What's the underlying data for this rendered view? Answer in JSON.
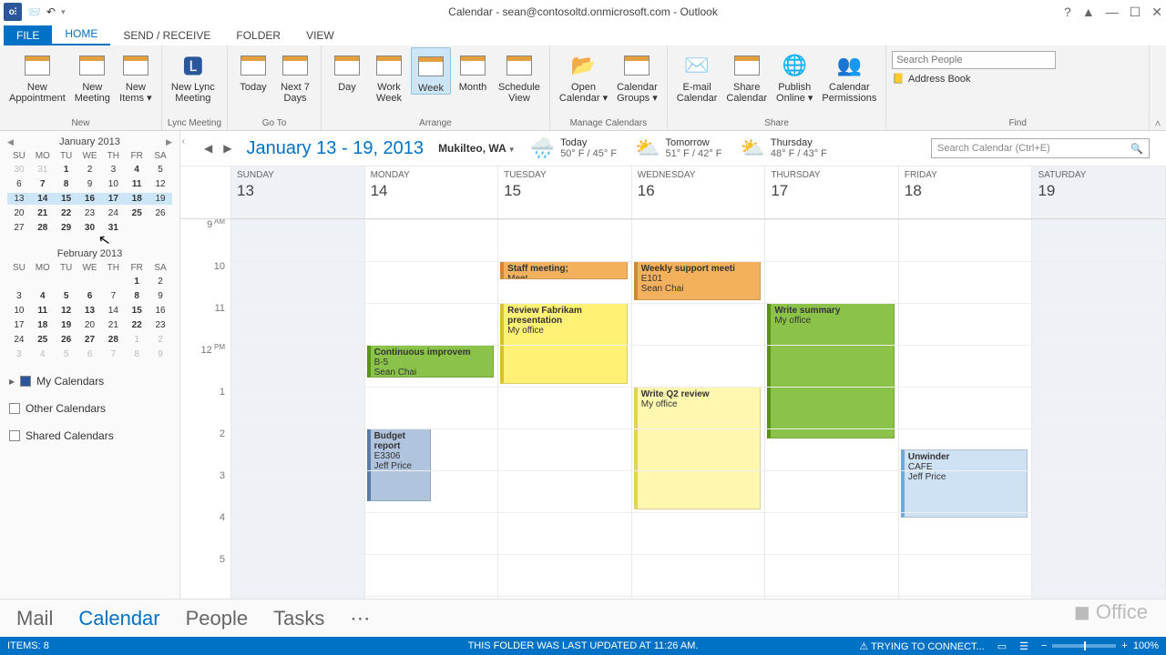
{
  "window": {
    "title": "Calendar - sean@contosoltd.onmicrosoft.com - Outlook"
  },
  "tabs": {
    "file": "FILE",
    "home": "HOME",
    "sendreceive": "SEND / RECEIVE",
    "folder": "FOLDER",
    "view": "VIEW"
  },
  "ribbon": {
    "new": {
      "label": "New",
      "new_appointment": "New\nAppointment",
      "new_meeting": "New\nMeeting",
      "new_items": "New\nItems ▾"
    },
    "lync": {
      "label": "Lync Meeting",
      "btn": "New Lync\nMeeting"
    },
    "goto": {
      "label": "Go To",
      "today": "Today",
      "next7": "Next 7\nDays"
    },
    "arrange": {
      "label": "Arrange",
      "day": "Day",
      "workweek": "Work\nWeek",
      "week": "Week",
      "month": "Month",
      "schedule": "Schedule\nView"
    },
    "manage": {
      "label": "Manage Calendars",
      "open": "Open\nCalendar ▾",
      "groups": "Calendar\nGroups ▾"
    },
    "share": {
      "label": "Share",
      "email": "E-mail\nCalendar",
      "share": "Share\nCalendar",
      "publish": "Publish\nOnline ▾",
      "perms": "Calendar\nPermissions"
    },
    "find": {
      "label": "Find",
      "search_placeholder": "Search People",
      "address_book": "Address Book"
    }
  },
  "minical1": {
    "title": "January 2013",
    "dow": [
      "SU",
      "MO",
      "TU",
      "WE",
      "TH",
      "FR",
      "SA"
    ],
    "rows": [
      [
        "30g",
        "31g",
        "1b",
        "2",
        "3",
        "4b",
        "5"
      ],
      [
        "6",
        "7b",
        "8b",
        "9",
        "10",
        "11b",
        "12"
      ],
      [
        "13w",
        "14wb",
        "15wb",
        "16wb",
        "17wb",
        "18wb",
        "19w"
      ],
      [
        "20",
        "21b",
        "22b",
        "23",
        "24",
        "25b",
        "26"
      ],
      [
        "27",
        "28b",
        "29b",
        "30b",
        "31b",
        "",
        ""
      ]
    ]
  },
  "minical2": {
    "title": "February 2013",
    "dow": [
      "SU",
      "MO",
      "TU",
      "WE",
      "TH",
      "FR",
      "SA"
    ],
    "rows": [
      [
        "",
        "",
        "",
        "",
        "",
        "1b",
        "2"
      ],
      [
        "3",
        "4b",
        "5b",
        "6b",
        "7",
        "8b",
        "9"
      ],
      [
        "10",
        "11b",
        "12b",
        "13b",
        "14",
        "15b",
        "16"
      ],
      [
        "17",
        "18b",
        "19b",
        "20",
        "21",
        "22b",
        "23"
      ],
      [
        "24",
        "25b",
        "26b",
        "27b",
        "28b",
        "1g",
        "2g"
      ],
      [
        "3g",
        "4g",
        "5g",
        "6g",
        "7g",
        "8g",
        "9g"
      ]
    ]
  },
  "calsets": {
    "my": "My Calendars",
    "other": "Other Calendars",
    "shared": "Shared Calendars"
  },
  "calhead": {
    "range": "January 13 - 19, 2013",
    "loc": "Mukilteo, WA",
    "wx": [
      {
        "icon": "🌧️",
        "label": "Today",
        "temp": "50° F / 45° F"
      },
      {
        "icon": "⛅",
        "label": "Tomorrow",
        "temp": "51° F / 42° F"
      },
      {
        "icon": "⛅",
        "label": "Thursday",
        "temp": "48° F / 43° F"
      }
    ],
    "search_placeholder": "Search Calendar (Ctrl+E)"
  },
  "days": [
    {
      "name": "SUNDAY",
      "num": "13"
    },
    {
      "name": "MONDAY",
      "num": "14"
    },
    {
      "name": "TUESDAY",
      "num": "15"
    },
    {
      "name": "WEDNESDAY",
      "num": "16"
    },
    {
      "name": "THURSDAY",
      "num": "17"
    },
    {
      "name": "FRIDAY",
      "num": "18"
    },
    {
      "name": "SATURDAY",
      "num": "19"
    }
  ],
  "hours": [
    "9 AM",
    "10",
    "11",
    "12 PM",
    "1",
    "2",
    "3",
    "4",
    "5"
  ],
  "events": {
    "mon_cont": {
      "title": "Continuous improvem",
      "loc": "B-5",
      "who": "Sean Chai"
    },
    "mon_budget": {
      "title": "Budget report",
      "loc": "E3306",
      "who": "Jeff Price"
    },
    "tue_staff": {
      "title": "Staff meeting;",
      "extra": "Meet"
    },
    "tue_review": {
      "title": "Review Fabrikam presentation",
      "loc": "My office"
    },
    "wed_support": {
      "title": "Weekly support meeti",
      "loc": "E101",
      "who": "Sean Chai"
    },
    "wed_q2": {
      "title": "Write Q2 review",
      "loc": "My office"
    },
    "thu_sum": {
      "title": "Write summary",
      "loc": "My office"
    },
    "fri_unw": {
      "title": "Unwinder",
      "loc": "CAFE",
      "who": "Jeff Price"
    }
  },
  "nav": {
    "mail": "Mail",
    "cal": "Calendar",
    "people": "People",
    "tasks": "Tasks",
    "more": "⋯"
  },
  "status": {
    "items": "ITEMS: 8",
    "updated": "THIS FOLDER WAS LAST UPDATED AT 11:26 AM.",
    "connect": "TRYING TO CONNECT...",
    "zoom": "100%"
  }
}
